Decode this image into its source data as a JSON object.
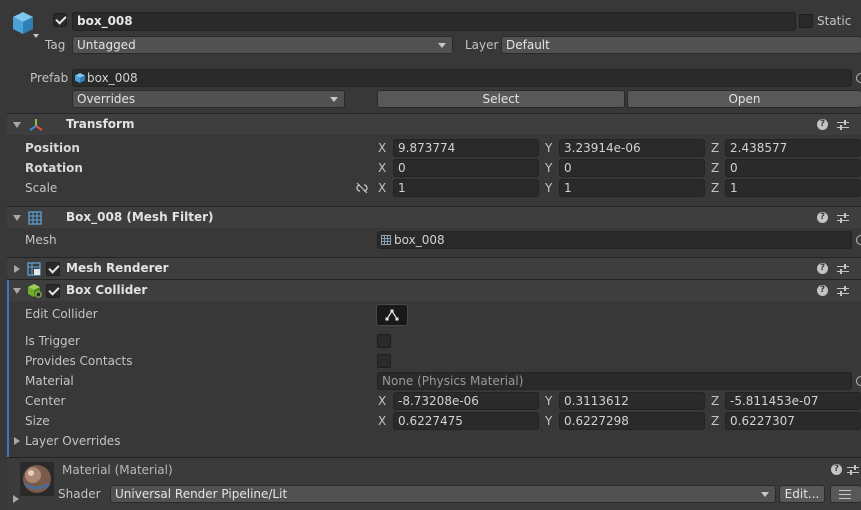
{
  "gameobject": {
    "name": "box_008",
    "static_label": "Static",
    "tag_label": "Tag",
    "tag_value": "Untagged",
    "layer_label": "Layer",
    "layer_value": "Default",
    "prefab_label": "Prefab",
    "prefab_value": "box_008",
    "overrides_label": "Overrides",
    "select_label": "Select",
    "open_label": "Open"
  },
  "transform": {
    "title": "Transform",
    "position_label": "Position",
    "rotation_label": "Rotation",
    "scale_label": "Scale",
    "axis_x": "X",
    "axis_y": "Y",
    "axis_z": "Z",
    "position": {
      "x": "9.873774",
      "y": "3.23914e-06",
      "z": "2.438577"
    },
    "rotation": {
      "x": "0",
      "y": "0",
      "z": "0"
    },
    "scale": {
      "x": "1",
      "y": "1",
      "z": "1"
    }
  },
  "mesh_filter": {
    "title": "Box_008 (Mesh Filter)",
    "mesh_label": "Mesh",
    "mesh_value": "box_008"
  },
  "mesh_renderer": {
    "title": "Mesh Renderer"
  },
  "box_collider": {
    "title": "Box Collider",
    "edit_collider_label": "Edit Collider",
    "is_trigger_label": "Is Trigger",
    "provides_contacts_label": "Provides Contacts",
    "material_label": "Material",
    "material_value": "None (Physics Material)",
    "center_label": "Center",
    "size_label": "Size",
    "layer_overrides_label": "Layer Overrides",
    "center": {
      "x": "-8.73208e-06",
      "y": "0.3113612",
      "z": "-5.811453e-07"
    },
    "size": {
      "x": "0.6227475",
      "y": "0.6227298",
      "z": "0.6227307"
    }
  },
  "material": {
    "title": "Material (Material)",
    "shader_label": "Shader",
    "shader_value": "Universal Render Pipeline/Lit",
    "edit_label": "Edit..."
  },
  "help_glyph": "?",
  "colors": {
    "background": "#383838",
    "header": "#3e3e3e",
    "field": "#2a2a2a",
    "accent": "#3a79bb"
  }
}
